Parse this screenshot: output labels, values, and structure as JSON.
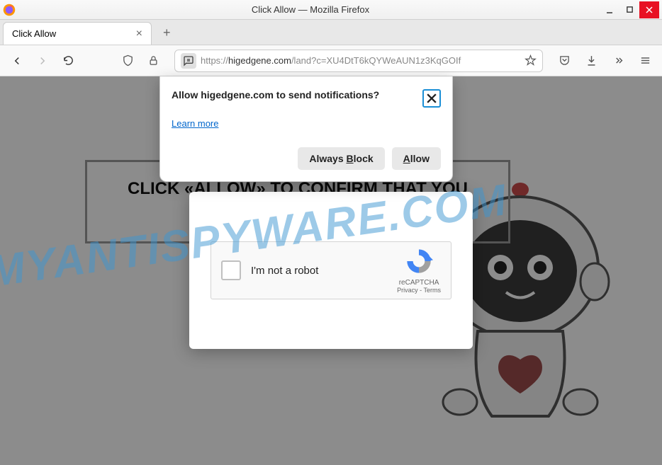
{
  "window": {
    "title": "Click Allow — Mozilla Firefox"
  },
  "tab": {
    "title": "Click Allow"
  },
  "url": {
    "protocol": "https://",
    "domain": "higedgene.com",
    "path": "/land?c=XU4DtT6kQYWeAUN1z3KqGOIf"
  },
  "notification": {
    "title": "Allow higedgene.com to send notifications?",
    "learn_more": "Learn more",
    "block_label": "Always Block",
    "block_prefix": "Always ",
    "block_u": "B",
    "block_suffix": "lock",
    "allow_u": "A",
    "allow_suffix": "llow"
  },
  "page": {
    "banner": "CLICK «ALLOW» TO CONFIRM THAT YOU"
  },
  "recaptcha": {
    "label": "I'm not a robot",
    "brand": "reCAPTCHA",
    "privacy": "Privacy",
    "terms": "Terms"
  },
  "watermark": "MYANTISPYWARE.COM"
}
